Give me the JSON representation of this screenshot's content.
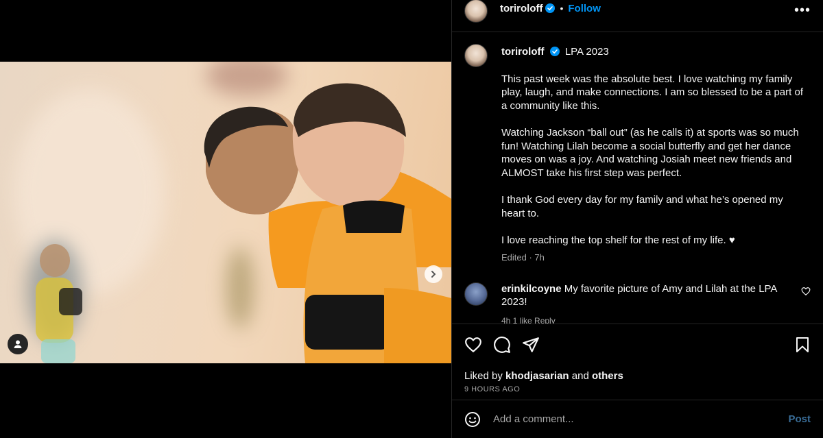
{
  "post": {
    "author": "toriroloff",
    "follow_label": "Follow",
    "separator": "•",
    "more_label": "•••",
    "location": "LPA 2023",
    "caption_paragraphs": [
      "This past week was the absolute best. I love watching my family play, laugh, and make connections. I am so blessed to be a part of a community like this.",
      "Watching Jackson “ball out” (as he calls it) at sports was so much fun! Watching Lilah become a social butterfly and get her dance moves on was a joy. And watching Josiah meet new friends and ALMOST take his first step was perfect.",
      "I thank God every day for my family and what he’s opened my heart to.",
      "I love reaching the top shelf for the rest of my life. ♥"
    ],
    "caption_meta": "Edited · 7h"
  },
  "comments": [
    {
      "user": "erinkilcoyne",
      "text": "My favorite picture of Amy and Lilah at the LPA 2023!",
      "meta": "4h   1 like   Reply"
    }
  ],
  "likes": {
    "prefix": "Liked by",
    "user": "khodjasarian",
    "joiner": "and",
    "others": "others",
    "time": "9 HOURS AGO"
  },
  "add_comment": {
    "placeholder": "Add a comment...",
    "post_label": "Post"
  },
  "carousel": {
    "slide_count": 9,
    "active_index": 0
  },
  "colors": {
    "accent": "#0095f6",
    "background": "#000000",
    "verified": "#0095f6"
  }
}
